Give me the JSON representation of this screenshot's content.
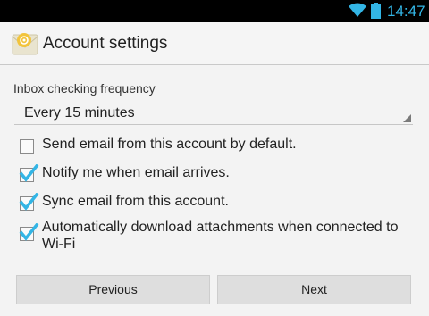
{
  "status_bar": {
    "time": "14:47",
    "wifi_icon": "wifi-icon",
    "battery_icon": "battery-icon",
    "accent_color": "#33b5e5"
  },
  "action_bar": {
    "title": "Account settings",
    "icon": "email-envelope-icon"
  },
  "form": {
    "frequency_label": "Inbox checking frequency",
    "frequency_value": "Every 15 minutes",
    "options": [
      {
        "label": "Send email from this account by default.",
        "checked": false
      },
      {
        "label": "Notify me when email arrives.",
        "checked": true
      },
      {
        "label": "Sync email from this account.",
        "checked": true
      },
      {
        "label": "Automatically download attachments when connected to Wi-Fi",
        "checked": true
      }
    ]
  },
  "buttons": {
    "previous_label": "Previous",
    "next_label": "Next"
  },
  "colors": {
    "check_color": "#33b5e5",
    "background": "#f3f3f3"
  }
}
